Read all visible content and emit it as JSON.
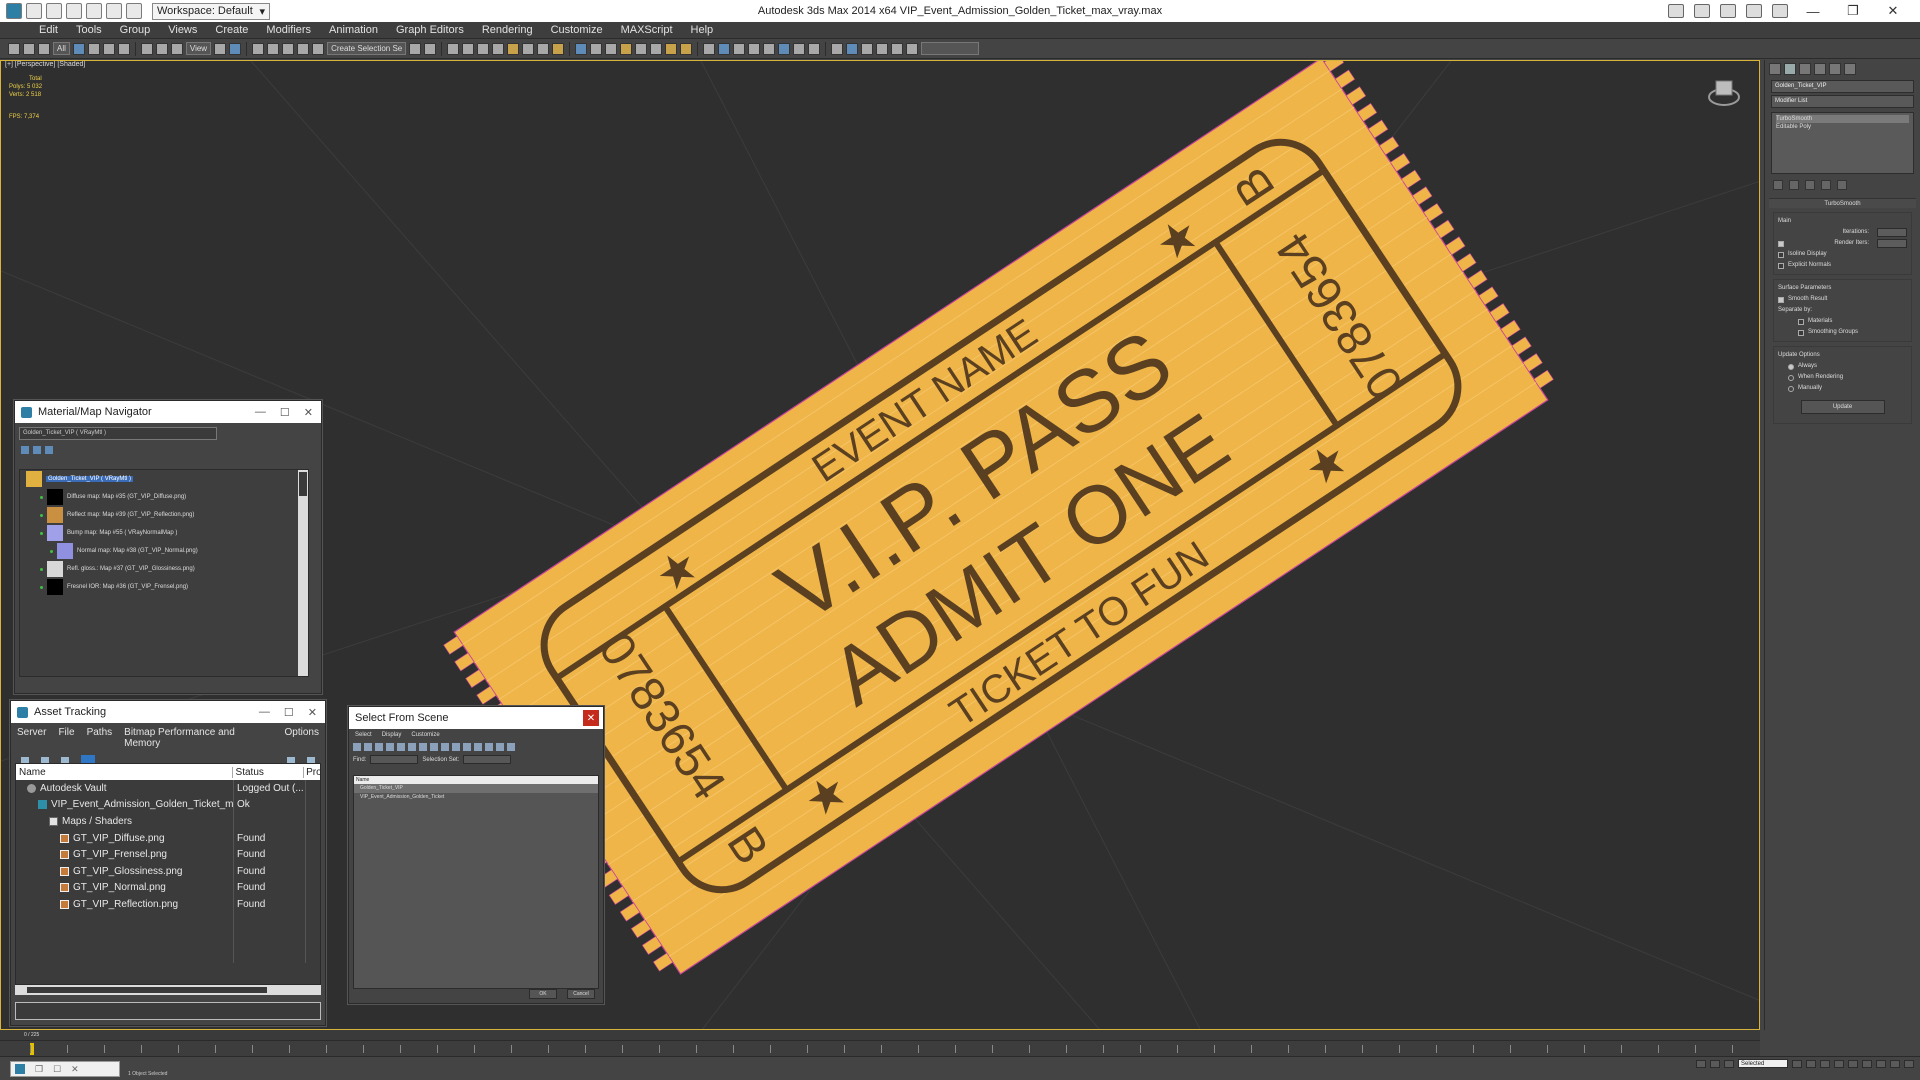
{
  "window": {
    "title": "Autodesk 3ds Max  2014 x64     VIP_Event_Admission_Golden_Ticket_max_vray.max",
    "workspace": "Workspace: Default"
  },
  "menu": [
    "Edit",
    "Tools",
    "Group",
    "Views",
    "Create",
    "Modifiers",
    "Animation",
    "Graph Editors",
    "Rendering",
    "Customize",
    "MAXScript",
    "Help"
  ],
  "toolbar": {
    "filter_all": "All",
    "ref_coord": "View",
    "named_selection": "Create Selection Se"
  },
  "viewport": {
    "label": "[+] [Perspective] [Shaded]",
    "stats": {
      "total_label": "Total",
      "polys_label": "Polys:",
      "polys_value": "5 032",
      "verts_label": "Verts:",
      "verts_value": "2 518",
      "fps_label": "FPS:",
      "fps_value": "7,374"
    },
    "ticket": {
      "event_name": "EVENT NAME",
      "vip_pass": "V.I.P. PASS",
      "admit_one": "ADMIT ONE",
      "ticket_to_fun": "TICKET TO FUN",
      "serial_top": "0783654",
      "serial_bottom": "0783654",
      "letter_top": "B",
      "letter_bottom": "B",
      "color": "#f0b548",
      "ink_color": "#5a4020"
    }
  },
  "command_panel": {
    "object_name": "Golden_Ticket_VIP",
    "modifier_list": "Modifier List",
    "stack": [
      "TurboSmooth",
      "Editable Poly"
    ],
    "rollout_title": "TurboSmooth",
    "main_group": "Main",
    "iterations_label": "Iterations:",
    "render_iters_label": "Render Iters:",
    "isoline": "Isoline Display",
    "explicit_normals": "Explicit Normals",
    "surface_params": "Surface Parameters",
    "smooth_result": "Smooth Result",
    "separate_by": "Separate by:",
    "materials": "Materials",
    "smoothing_groups": "Smoothing Groups",
    "update_options": "Update Options",
    "always": "Always",
    "when_rendering": "When Rendering",
    "manually": "Manually",
    "update_button": "Update"
  },
  "material_navigator": {
    "title": "Material/Map Navigator",
    "filter": "Golden_Ticket_VIP  ( VRayMtl )",
    "items": [
      {
        "label": "Golden_Ticket_VIP  ( VRayMtl )",
        "swatch": "#e0b040"
      },
      {
        "label": "Diffuse map: Map #35 (GT_VIP_Diffuse.png)",
        "swatch": "#000000"
      },
      {
        "label": "Reflect map: Map #39 (GT_VIP_Reflection.png)",
        "swatch": "#c89040"
      },
      {
        "label": "Bump map: Map #55  ( VRayNormalMap )",
        "swatch": "#a0a0e8"
      },
      {
        "label": "Normal map: Map #38 (GT_VIP_Normal.png)",
        "swatch": "#9090e0"
      },
      {
        "label": "Refl. gloss.: Map #37 (GT_VIP_Glossiness.png)",
        "swatch": "#d8d8d8"
      },
      {
        "label": "Fresnel IOR: Map #36 (GT_VIP_Frensel.png)",
        "swatch": "#000000"
      }
    ]
  },
  "asset_tracking": {
    "title": "Asset Tracking",
    "menu": [
      "Server",
      "File",
      "Paths",
      "Bitmap Performance and Memory",
      "Options"
    ],
    "columns": [
      "Name",
      "Status",
      "Proxy"
    ],
    "rows": [
      {
        "name": "Autodesk Vault",
        "status": "Logged Out (...",
        "icon": "vault",
        "indent": 1
      },
      {
        "name": "VIP_Event_Admission_Golden_Ticket_m...",
        "status": "Ok",
        "icon": "max",
        "indent": 2
      },
      {
        "name": "Maps / Shaders",
        "status": "",
        "icon": "folder",
        "indent": 3
      },
      {
        "name": "GT_VIP_Diffuse.png",
        "status": "Found",
        "icon": "img",
        "indent": 4
      },
      {
        "name": "GT_VIP_Frensel.png",
        "status": "Found",
        "icon": "img",
        "indent": 4
      },
      {
        "name": "GT_VIP_Glossiness.png",
        "status": "Found",
        "icon": "img",
        "indent": 4
      },
      {
        "name": "GT_VIP_Normal.png",
        "status": "Found",
        "icon": "img",
        "indent": 4
      },
      {
        "name": "GT_VIP_Reflection.png",
        "status": "Found",
        "icon": "img",
        "indent": 4
      }
    ]
  },
  "select_from_scene": {
    "title": "Select From Scene",
    "menu": [
      "Select",
      "Display",
      "Customize"
    ],
    "find_label": "Find:",
    "selection_set_label": "Selection Set:",
    "column_name": "Name",
    "items": [
      "Golden_Ticket_VIP",
      "VIP_Event_Admission_Golden_Ticket"
    ],
    "ok": "OK",
    "cancel": "Cancel"
  },
  "timeline": {
    "frame": "0 / 225"
  },
  "status": {
    "text": "1 Object Selected",
    "selection": "Selected"
  }
}
